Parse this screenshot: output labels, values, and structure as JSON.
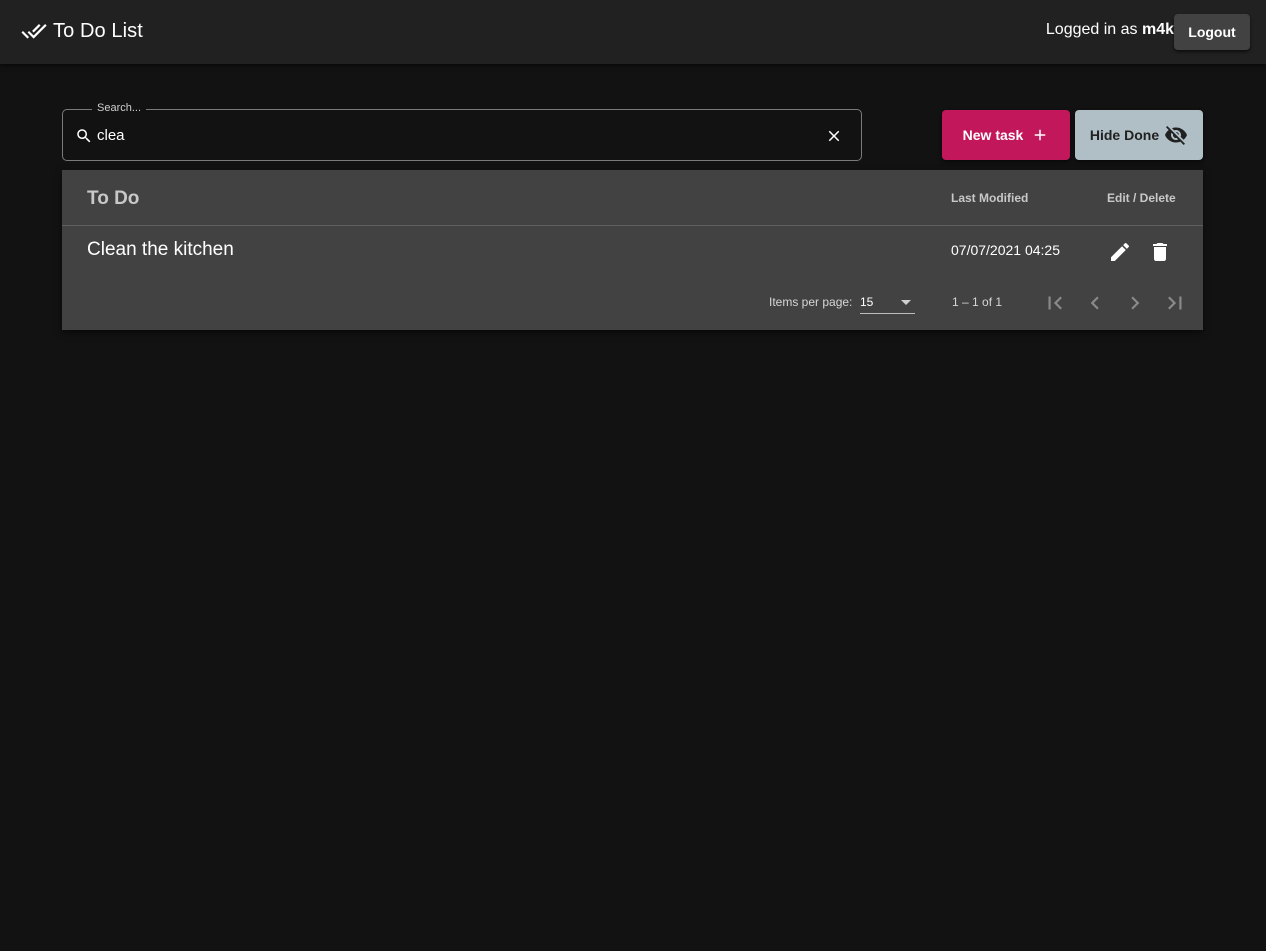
{
  "app": {
    "title": "To Do List",
    "user_prefix": "Logged in as ",
    "username": "m4k",
    "logout_label": "Logout"
  },
  "search": {
    "label": "Search...",
    "value": "clea"
  },
  "actions": {
    "new_task_label": "New task",
    "hide_done_label": "Hide Done"
  },
  "table": {
    "headers": {
      "task": "To Do",
      "modified": "Last Modified",
      "actions": "Edit / Delete"
    },
    "rows": [
      {
        "task": "Clean the kitchen",
        "modified": "07/07/2021 04:25"
      }
    ]
  },
  "paginator": {
    "items_per_page_label": "Items per page:",
    "items_per_page_value": "15",
    "range_label": "1 – 1 of 1"
  },
  "colors": {
    "background": "#121212",
    "toolbar": "#212121",
    "card": "#424242",
    "accent": "#c2185b",
    "secondary": "#b0bec5"
  },
  "icons": {
    "brand": "double-check-icon",
    "search": "search-icon",
    "clear": "close-icon",
    "new_task": "plus-icon",
    "hide_done": "eye-off-icon",
    "edit": "pencil-icon",
    "delete": "trash-icon",
    "first_page": "first-page-icon",
    "prev_page": "chevron-left-icon",
    "next_page": "chevron-right-icon",
    "last_page": "last-page-icon"
  }
}
